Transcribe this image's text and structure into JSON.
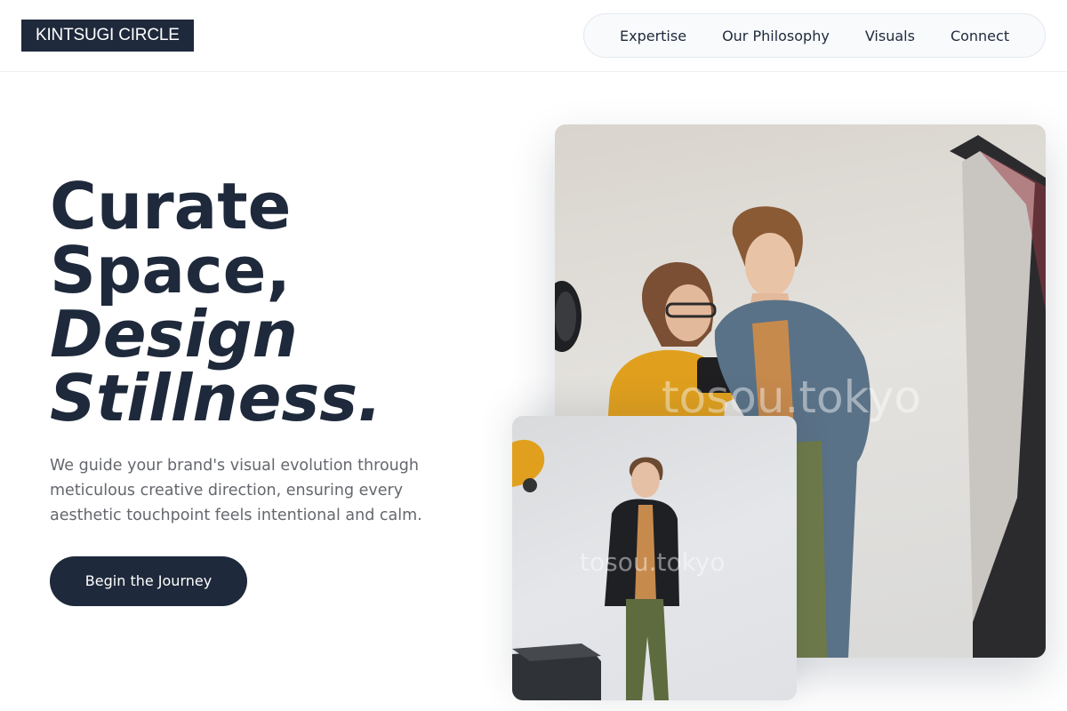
{
  "header": {
    "logo": "KINTSUGI CIRCLE",
    "nav": [
      "Expertise",
      "Our Philosophy",
      "Visuals",
      "Connect"
    ]
  },
  "hero": {
    "headline_line1": "Curate",
    "headline_line2": "Space,",
    "headline_line3": "Design",
    "headline_line4": "Stillness.",
    "subtitle": "We guide your brand's visual evolution through meticulous creative direction, ensuring every aesthetic touchpoint feels intentional and calm.",
    "cta": "Begin the Journey"
  },
  "images": {
    "watermark": "tosou.tokyo"
  },
  "colors": {
    "primary": "#1e293b",
    "muted_text": "#64676d",
    "nav_background": "#f8fafc"
  }
}
